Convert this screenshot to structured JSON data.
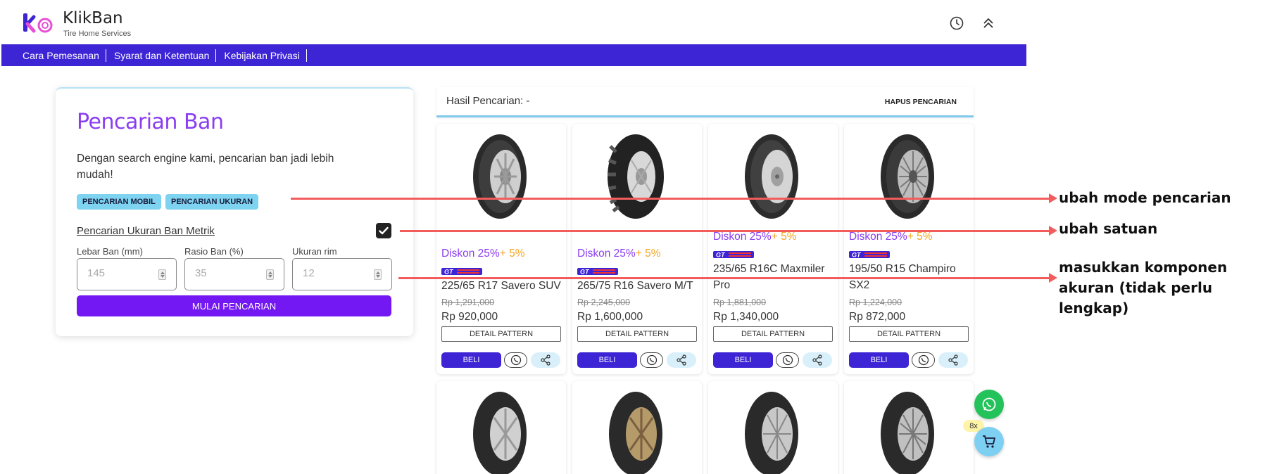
{
  "header": {
    "brand_name": "KlikBan",
    "brand_sub": "Tire Home Services",
    "history_icon": "history-icon",
    "collapse_icon": "chevron-double-up-icon"
  },
  "nav": {
    "items": [
      "Cara Pemesanan",
      "Syarat dan Ketentuan",
      "Kebijakan Privasi"
    ]
  },
  "search_panel": {
    "title": "Pencarian Ban",
    "description": "Dengan search engine kami, pencarian ban jadi lebih mudah!",
    "modes": [
      "PENCARIAN MOBIL",
      "PENCARIAN UKURAN"
    ],
    "metric_label": "Pencarian Ukuran Ban Metrik",
    "metric_checked": true,
    "fields": [
      {
        "label": "Lebar Ban (mm)",
        "placeholder": "145"
      },
      {
        "label": "Rasio Ban (%)",
        "placeholder": "35"
      },
      {
        "label": "Ukuran rim",
        "placeholder": "12"
      }
    ],
    "submit_label": "MULAI PENCARIAN"
  },
  "results": {
    "title": "Hasil Pencarian: -",
    "clear_label": "HAPUS PENCARIAN",
    "discount_main": "Diskon 25%",
    "discount_extra": "+ 5%",
    "detail_label": "DETAIL PATTERN",
    "buy_label": "BELI",
    "products": [
      {
        "name": "225/65 R17 Savero SUV",
        "old_price": "Rp 1,291,000",
        "price": "Rp 920,000",
        "brand": "GT Radial"
      },
      {
        "name": "265/75 R16 Savero M/T",
        "old_price": "Rp 2,245,000",
        "price": "Rp 1,600,000",
        "brand": "GT Radial"
      },
      {
        "name": "235/65 R16C Maxmiler Pro",
        "old_price": "Rp 1,881,000",
        "price": "Rp 1,340,000",
        "brand": "GT Radial"
      },
      {
        "name": "195/50 R15 Champiro SX2",
        "old_price": "Rp 1,224,000",
        "price": "Rp 872,000",
        "brand": "GT Radial"
      }
    ]
  },
  "floating": {
    "cart_count": "8x",
    "whatsapp_icon": "whatsapp-icon",
    "cart_icon": "cart-icon"
  },
  "annotations": [
    "ubah mode pencarian",
    "ubah satuan",
    "masukkan komponen akuran (tidak perlu lengkap)"
  ],
  "colors": {
    "nav_bg": "#3d24d4",
    "accent_purple": "#7318f2",
    "title_purple": "#8a3df0",
    "discount_orange": "#f5a623",
    "annotation_red": "#f25c5c",
    "chip_blue": "#7dd3f0"
  }
}
